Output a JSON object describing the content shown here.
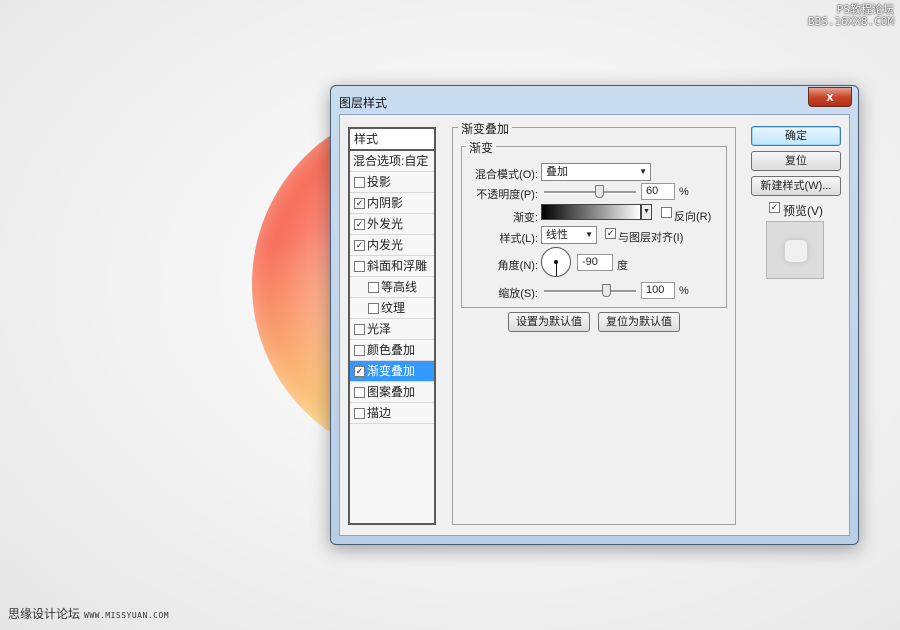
{
  "watermark_top": [
    "PS教程论坛",
    "BBS.16XX8.COM"
  ],
  "watermark_bottom": {
    "site": "思缘设计论坛",
    "url": "WWW.MISSYUAN.COM"
  },
  "dialog": {
    "title": "图层样式",
    "close_label": "x",
    "styles_header": "样式",
    "blend_options": "混合选项:自定",
    "style_items": [
      {
        "label": "投影",
        "checked": false,
        "selected": false
      },
      {
        "label": "内阴影",
        "checked": true,
        "selected": false
      },
      {
        "label": "外发光",
        "checked": true,
        "selected": false
      },
      {
        "label": "内发光",
        "checked": true,
        "selected": false
      },
      {
        "label": "斜面和浮雕",
        "checked": false,
        "selected": false
      },
      {
        "label": "等高线",
        "checked": false,
        "selected": false
      },
      {
        "label": "纹理",
        "checked": false,
        "selected": false
      },
      {
        "label": "光泽",
        "checked": false,
        "selected": false
      },
      {
        "label": "颜色叠加",
        "checked": false,
        "selected": false
      },
      {
        "label": "渐变叠加",
        "checked": true,
        "selected": true
      },
      {
        "label": "图案叠加",
        "checked": false,
        "selected": false
      },
      {
        "label": "描边",
        "checked": false,
        "selected": false
      }
    ],
    "section_title": "渐变叠加",
    "subsection_title": "渐变",
    "blend_mode_label": "混合模式(O):",
    "blend_mode_value": "叠加",
    "opacity_label": "不透明度(P):",
    "opacity_value": "60",
    "opacity_fraction": 0.6,
    "percent": "%",
    "gradient_label": "渐变:",
    "reverse_label": "反向(R)",
    "reverse_checked": false,
    "style_label": "样式(L):",
    "style_value": "线性",
    "align_label": "与图层对齐(I)",
    "align_checked": true,
    "angle_label": "角度(N):",
    "angle_value": "-90",
    "degree_unit": "度",
    "scale_label": "缩放(S):",
    "scale_value": "100",
    "scale_fraction": 0.67,
    "make_default": "设置为默认值",
    "reset_default": "复位为默认值",
    "ok": "确定",
    "reset": "复位",
    "new_style": "新建样式(W)...",
    "preview_label": "预览(V)",
    "preview_checked": true
  }
}
